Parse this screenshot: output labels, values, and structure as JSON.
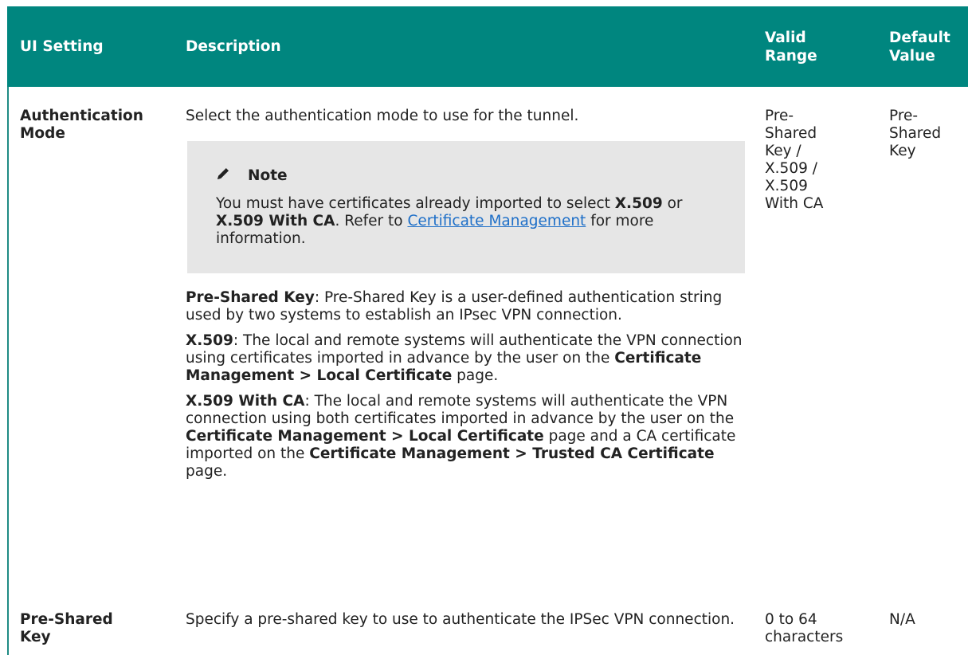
{
  "table": {
    "headers": {
      "ui_setting": "UI Setting",
      "description": "Description",
      "valid_range_1": "Valid",
      "valid_range_2": "Range",
      "default_value_1": "Default",
      "default_value_2": "Value"
    },
    "rows": [
      {
        "name_1": "Authentication",
        "name_2": "Mode",
        "description": "Select the authentication mode to use for the tunnel.",
        "note": {
          "icon": "pencil-icon",
          "title": "Note",
          "text_1": "You must have certificates already imported to select ",
          "bold_1": "X.509",
          "text_2": " or ",
          "bold_2": "X.509 With CA",
          "text_3": ". Refer to ",
          "link": "Certificate Management",
          "text_4": " for more information."
        },
        "psk": {
          "label": "Pre-Shared Key",
          "text": ": Pre-Shared Key is a user-defined authentication string used by two systems to establish an IPsec VPN connection."
        },
        "x509": {
          "label": "X.509",
          "text_1": ": The local and remote systems will authenticate the VPN connection using certificates imported in advance by the user on the ",
          "bold": "Certificate Management > Local Certificate",
          "text_2": " page."
        },
        "x509ca": {
          "label": "X.509 With CA",
          "text_1": ": The local and remote systems will authenticate the VPN connection using both certificates imported in advance by the user on the ",
          "bold_1": "Certificate Management > Local Certificate",
          "text_2": " page and a CA certificate imported on the ",
          "bold_2": "Certificate Management > Trusted CA Certificate",
          "text_3": " page."
        },
        "valid_range": [
          "Pre-",
          "Shared",
          "Key /",
          "X.509 /",
          "X.509",
          "With CA"
        ],
        "default_value": [
          "Pre-",
          "Shared",
          "Key"
        ]
      },
      {
        "name_1": "Pre-Shared",
        "name_2": "Key",
        "description": "Specify a pre-shared key to use to authenticate the IPSec VPN connection.",
        "valid_range": [
          "0 to 64",
          "characters"
        ],
        "default_value": "N/A"
      }
    ]
  },
  "colors": {
    "header_bg": "#00867f",
    "header_text": "#ffffff",
    "note_bg": "#e6e6e6",
    "link": "#1e6fc8"
  }
}
